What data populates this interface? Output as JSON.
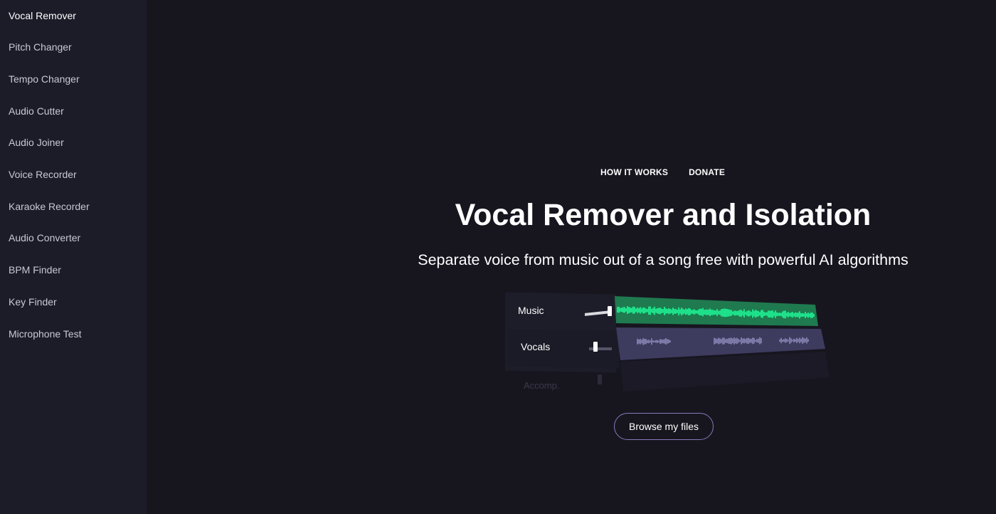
{
  "sidebar": {
    "items": [
      {
        "label": "Vocal Remover",
        "active": true
      },
      {
        "label": "Pitch Changer",
        "active": false
      },
      {
        "label": "Tempo Changer",
        "active": false
      },
      {
        "label": "Audio Cutter",
        "active": false
      },
      {
        "label": "Audio Joiner",
        "active": false
      },
      {
        "label": "Voice Recorder",
        "active": false
      },
      {
        "label": "Karaoke Recorder",
        "active": false
      },
      {
        "label": "Audio Converter",
        "active": false
      },
      {
        "label": "BPM Finder",
        "active": false
      },
      {
        "label": "Key Finder",
        "active": false
      },
      {
        "label": "Microphone Test",
        "active": false
      }
    ]
  },
  "topnav": {
    "how_it_works": "HOW IT WORKS",
    "donate": "DONATE"
  },
  "hero": {
    "title": "Vocal Remover and Isolation",
    "subtitle": "Separate voice from music out of a song free with powerful AI algorithms"
  },
  "illustration": {
    "tracks": [
      {
        "label": "Music",
        "waveform_color": "#1fe08a",
        "track_bg": "#1f7a4f"
      },
      {
        "label": "Vocals",
        "waveform_color": "#8b89b8",
        "track_bg": "#3d3b5e"
      },
      {
        "label": "Accomp.",
        "waveform_color": "#2a2a3a",
        "track_bg": "#1e1d2a"
      }
    ]
  },
  "actions": {
    "browse_label": "Browse my files"
  },
  "colors": {
    "page_bg": "#17161f",
    "sidebar_bg": "#1c1c29",
    "button_border": "#8778b8"
  }
}
